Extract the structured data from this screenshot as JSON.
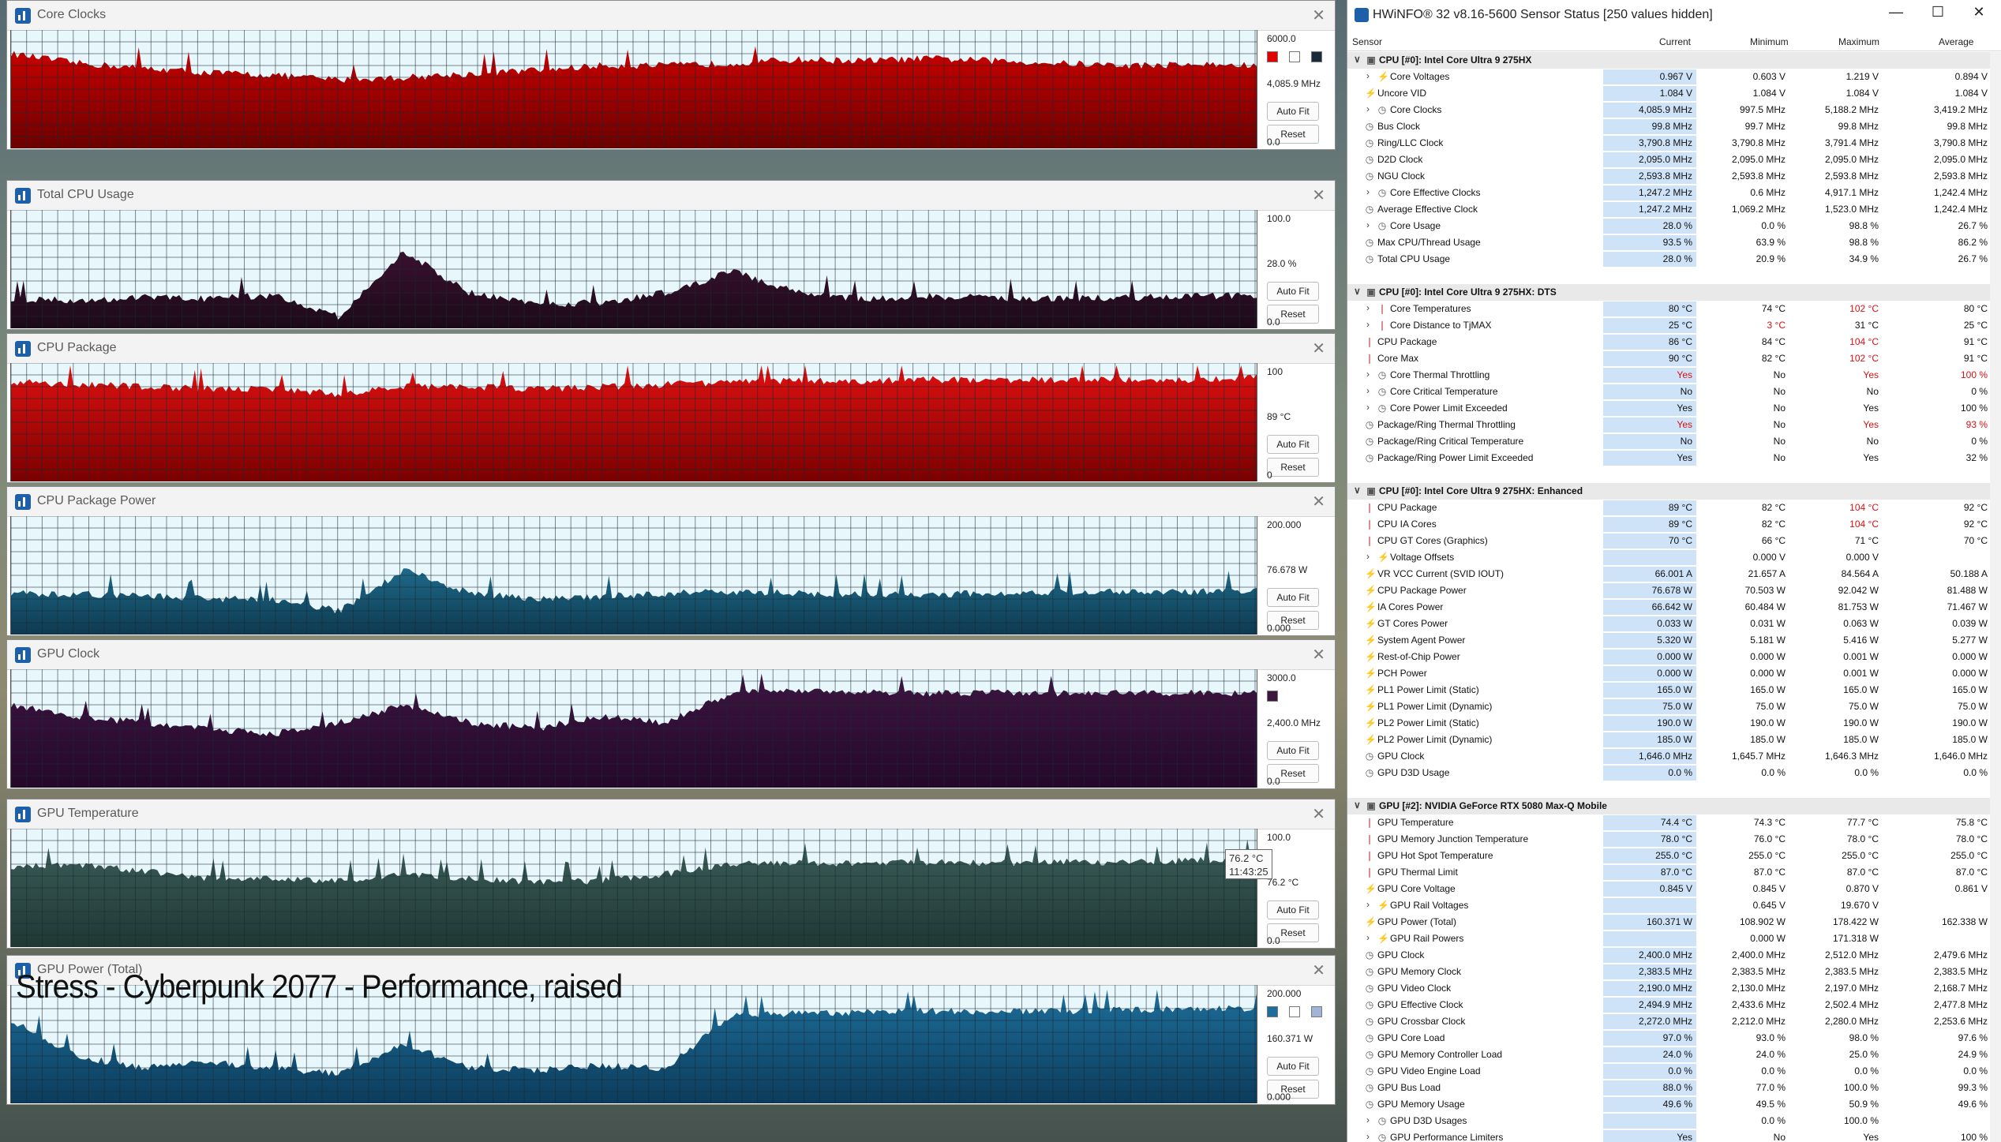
{
  "graphs": [
    {
      "title": "Core Clocks",
      "max": "6000.0",
      "current": "4,085.9 MHz",
      "min": "0.0",
      "autofit": "Auto Fit",
      "reset": "Reset",
      "colors": {
        "fill_top": "#cc0000",
        "fill_bottom": "#6b0000",
        "background": "#e8f7fc"
      },
      "swatches": [
        "#e00000",
        "#ffffff",
        "#1a2b3c"
      ],
      "series_profile": [
        0.8,
        0.72,
        0.68,
        0.64,
        0.62,
        0.58,
        0.6,
        0.63,
        0.66,
        0.7,
        0.7,
        0.72,
        0.75,
        0.74,
        0.76,
        0.74,
        0.72,
        0.7,
        0.71,
        0.7
      ]
    },
    {
      "title": "Total CPU Usage",
      "max": "100.0",
      "current": "28.0 %",
      "min": "0.0",
      "autofit": "Auto Fit",
      "reset": "Reset",
      "colors": {
        "fill_top": "#3a1030",
        "fill_bottom": "#1c0a18",
        "background": "#e8f7fc"
      },
      "swatches": [],
      "series_profile": [
        0.25,
        0.24,
        0.26,
        0.25,
        0.28,
        0.1,
        0.65,
        0.3,
        0.2,
        0.22,
        0.3,
        0.48,
        0.3,
        0.25,
        0.27,
        0.26,
        0.25,
        0.26,
        0.27,
        0.28
      ]
    },
    {
      "title": "CPU Package",
      "max": "100",
      "current": "89 °C",
      "min": "0",
      "autofit": "Auto Fit",
      "reset": "Reset",
      "colors": {
        "fill_top": "#e01010",
        "fill_bottom": "#7a0000",
        "background": "#e8f7fc"
      },
      "swatches": [],
      "series_profile": [
        0.84,
        0.82,
        0.8,
        0.78,
        0.78,
        0.74,
        0.8,
        0.8,
        0.78,
        0.8,
        0.82,
        0.84,
        0.85,
        0.85,
        0.86,
        0.86,
        0.86,
        0.86,
        0.86,
        0.88
      ]
    },
    {
      "title": "CPU Package Power",
      "max": "200.000",
      "current": "76.678 W",
      "min": "0.000",
      "autofit": "Auto Fit",
      "reset": "Reset",
      "colors": {
        "fill_top": "#1e6a8a",
        "fill_bottom": "#0e3a50",
        "background": "#e8f7fc"
      },
      "swatches": [],
      "series_profile": [
        0.35,
        0.34,
        0.33,
        0.3,
        0.3,
        0.2,
        0.55,
        0.35,
        0.3,
        0.32,
        0.35,
        0.36,
        0.35,
        0.34,
        0.34,
        0.35,
        0.36,
        0.36,
        0.36,
        0.38
      ]
    },
    {
      "title": "GPU Clock",
      "max": "3000.0",
      "current": "2,400.0 MHz",
      "min": "0.0",
      "autofit": "Auto Fit",
      "reset": "Reset",
      "colors": {
        "fill_top": "#3d1540",
        "fill_bottom": "#24082a",
        "background": "#e8f7fc"
      },
      "swatches": [
        "#3d1540"
      ],
      "series_profile": [
        0.7,
        0.6,
        0.55,
        0.5,
        0.45,
        0.55,
        0.7,
        0.55,
        0.5,
        0.6,
        0.55,
        0.8,
        0.81,
        0.81,
        0.8,
        0.8,
        0.8,
        0.8,
        0.8,
        0.8
      ]
    },
    {
      "title": "GPU Temperature",
      "max": "100.0",
      "current": "76.2 °C",
      "min": "0.0",
      "autofit": "Auto Fit",
      "reset": "Reset",
      "colors": {
        "fill_top": "#3c5e5a",
        "fill_bottom": "#1f3834",
        "background": "#e8f7fc"
      },
      "swatches": [],
      "series_profile": [
        0.68,
        0.7,
        0.64,
        0.58,
        0.58,
        0.56,
        0.62,
        0.58,
        0.55,
        0.56,
        0.62,
        0.7,
        0.71,
        0.71,
        0.72,
        0.71,
        0.72,
        0.72,
        0.73,
        0.74
      ]
    },
    {
      "title": "GPU Power (Total)",
      "max": "200.000",
      "current": "160.371 W",
      "min": "0.000",
      "autofit": "Auto Fit",
      "reset": "Reset",
      "colors": {
        "fill_top": "#1d6e9a",
        "fill_bottom": "#0c3c5c",
        "background": "#e8f7fc"
      },
      "swatches": [
        "#1d6e9a",
        "#ffffff",
        "#9fb4d6"
      ],
      "series_profile": [
        0.7,
        0.4,
        0.3,
        0.35,
        0.3,
        0.25,
        0.5,
        0.3,
        0.28,
        0.32,
        0.3,
        0.75,
        0.76,
        0.77,
        0.78,
        0.78,
        0.78,
        0.79,
        0.8,
        0.8
      ]
    }
  ],
  "tooltip": {
    "value": "76.2 °C",
    "time": "11:43:25"
  },
  "caption": "Stress - Cyberpunk 2077 - Performance, raised",
  "hwinfo": {
    "title": "HWiNFO® 32 v8.16-5600 Sensor Status [250 values hidden]",
    "window_controls": {
      "minimize": "—",
      "maximize": "☐",
      "close": "✕"
    },
    "columns": {
      "sensor": "Sensor",
      "current": "Current",
      "minimum": "Minimum",
      "maximum": "Maximum",
      "average": "Average"
    },
    "rows": [
      {
        "t": "group",
        "label": "CPU [#0]: Intel Core Ultra 9 275HX"
      },
      {
        "label": "Core Voltages",
        "icon": "volt",
        "expand": true,
        "cur": "0.967 V",
        "min": "0.603 V",
        "max": "1.219 V",
        "avg": "0.894 V"
      },
      {
        "label": "Uncore VID",
        "icon": "volt",
        "cur": "1.084 V",
        "min": "1.084 V",
        "max": "1.084 V",
        "avg": "1.084 V"
      },
      {
        "label": "Core Clocks",
        "icon": "clock",
        "expand": true,
        "cur": "4,085.9 MHz",
        "min": "997.5 MHz",
        "max": "5,188.2 MHz",
        "avg": "3,419.2 MHz"
      },
      {
        "label": "Bus Clock",
        "icon": "clock",
        "cur": "99.8 MHz",
        "min": "99.7 MHz",
        "max": "99.8 MHz",
        "avg": "99.8 MHz"
      },
      {
        "label": "Ring/LLC Clock",
        "icon": "clock",
        "cur": "3,790.8 MHz",
        "min": "3,790.8 MHz",
        "max": "3,791.4 MHz",
        "avg": "3,790.8 MHz"
      },
      {
        "label": "D2D Clock",
        "icon": "clock",
        "cur": "2,095.0 MHz",
        "min": "2,095.0 MHz",
        "max": "2,095.0 MHz",
        "avg": "2,095.0 MHz"
      },
      {
        "label": "NGU Clock",
        "icon": "clock",
        "cur": "2,593.8 MHz",
        "min": "2,593.8 MHz",
        "max": "2,593.8 MHz",
        "avg": "2,593.8 MHz"
      },
      {
        "label": "Core Effective Clocks",
        "icon": "clock",
        "expand": true,
        "cur": "1,247.2 MHz",
        "min": "0.6 MHz",
        "max": "4,917.1 MHz",
        "avg": "1,242.4 MHz"
      },
      {
        "label": "Average Effective Clock",
        "icon": "clock",
        "cur": "1,247.2 MHz",
        "min": "1,069.2 MHz",
        "max": "1,523.0 MHz",
        "avg": "1,242.4 MHz"
      },
      {
        "label": "Core Usage",
        "icon": "clock",
        "expand": true,
        "cur": "28.0 %",
        "min": "0.0 %",
        "max": "98.8 %",
        "avg": "26.7 %"
      },
      {
        "label": "Max CPU/Thread Usage",
        "icon": "clock",
        "cur": "93.5 %",
        "min": "63.9 %",
        "max": "98.8 %",
        "avg": "86.2 %"
      },
      {
        "label": "Total CPU Usage",
        "icon": "clock",
        "cur": "28.0 %",
        "min": "20.9 %",
        "max": "34.9 %",
        "avg": "26.7 %"
      },
      {
        "t": "blank"
      },
      {
        "t": "group",
        "label": "CPU [#0]: Intel Core Ultra 9 275HX: DTS"
      },
      {
        "label": "Core Temperatures",
        "icon": "temp",
        "expand": true,
        "cur": "80 °C",
        "min": "74 °C",
        "max": "102 °C",
        "avg": "80 °C",
        "maxRed": true
      },
      {
        "label": "Core Distance to TjMAX",
        "icon": "temp",
        "expand": true,
        "cur": "25 °C",
        "min": "3 °C",
        "max": "31 °C",
        "avg": "25 °C",
        "minRed": true
      },
      {
        "label": "CPU Package",
        "icon": "temp",
        "cur": "86 °C",
        "min": "84 °C",
        "max": "104 °C",
        "avg": "91 °C",
        "maxRed": true
      },
      {
        "label": "Core Max",
        "icon": "temp",
        "cur": "90 °C",
        "min": "82 °C",
        "max": "102 °C",
        "avg": "91 °C",
        "maxRed": true
      },
      {
        "label": "Core Thermal Throttling",
        "icon": "clock",
        "expand": true,
        "cur": "Yes",
        "min": "No",
        "max": "Yes",
        "avg": "100 %",
        "curRed": true,
        "maxRed": true,
        "avgRed": true
      },
      {
        "label": "Core Critical Temperature",
        "icon": "clock",
        "expand": true,
        "cur": "No",
        "min": "No",
        "max": "No",
        "avg": "0 %"
      },
      {
        "label": "Core Power Limit Exceeded",
        "icon": "clock",
        "expand": true,
        "cur": "Yes",
        "min": "No",
        "max": "Yes",
        "avg": "100 %"
      },
      {
        "label": "Package/Ring Thermal Throttling",
        "icon": "clock",
        "cur": "Yes",
        "min": "No",
        "max": "Yes",
        "avg": "93 %",
        "curRed": true,
        "maxRed": true,
        "avgRed": true
      },
      {
        "label": "Package/Ring Critical Temperature",
        "icon": "clock",
        "cur": "No",
        "min": "No",
        "max": "No",
        "avg": "0 %"
      },
      {
        "label": "Package/Ring Power Limit Exceeded",
        "icon": "clock",
        "cur": "Yes",
        "min": "No",
        "max": "Yes",
        "avg": "32 %"
      },
      {
        "t": "blank"
      },
      {
        "t": "group",
        "label": "CPU [#0]: Intel Core Ultra 9 275HX: Enhanced"
      },
      {
        "label": "CPU Package",
        "icon": "temp",
        "cur": "89 °C",
        "min": "82 °C",
        "max": "104 °C",
        "avg": "92 °C",
        "maxRed": true
      },
      {
        "label": "CPU IA Cores",
        "icon": "temp",
        "cur": "89 °C",
        "min": "82 °C",
        "max": "104 °C",
        "avg": "92 °C",
        "maxRed": true
      },
      {
        "label": "CPU GT Cores (Graphics)",
        "icon": "temp",
        "cur": "70 °C",
        "min": "66 °C",
        "max": "71 °C",
        "avg": "70 °C"
      },
      {
        "label": "Voltage Offsets",
        "icon": "volt",
        "expand": true,
        "cur": "",
        "min": "0.000 V",
        "max": "0.000 V",
        "avg": ""
      },
      {
        "label": "VR VCC Current (SVID IOUT)",
        "icon": "volt",
        "cur": "66.001 A",
        "min": "21.657 A",
        "max": "84.564 A",
        "avg": "50.188 A"
      },
      {
        "label": "CPU Package Power",
        "icon": "volt",
        "cur": "76.678 W",
        "min": "70.503 W",
        "max": "92.042 W",
        "avg": "81.488 W"
      },
      {
        "label": "IA Cores Power",
        "icon": "volt",
        "cur": "66.642 W",
        "min": "60.484 W",
        "max": "81.753 W",
        "avg": "71.467 W"
      },
      {
        "label": "GT Cores Power",
        "icon": "volt",
        "cur": "0.033 W",
        "min": "0.031 W",
        "max": "0.063 W",
        "avg": "0.039 W"
      },
      {
        "label": "System Agent Power",
        "icon": "volt",
        "cur": "5.320 W",
        "min": "5.181 W",
        "max": "5.416 W",
        "avg": "5.277 W"
      },
      {
        "label": "Rest-of-Chip Power",
        "icon": "volt",
        "cur": "0.000 W",
        "min": "0.000 W",
        "max": "0.001 W",
        "avg": "0.000 W"
      },
      {
        "label": "PCH Power",
        "icon": "volt",
        "cur": "0.000 W",
        "min": "0.000 W",
        "max": "0.001 W",
        "avg": "0.000 W"
      },
      {
        "label": "PL1 Power Limit (Static)",
        "icon": "volt",
        "cur": "165.0 W",
        "min": "165.0 W",
        "max": "165.0 W",
        "avg": "165.0 W"
      },
      {
        "label": "PL1 Power Limit (Dynamic)",
        "icon": "volt",
        "cur": "75.0 W",
        "min": "75.0 W",
        "max": "75.0 W",
        "avg": "75.0 W"
      },
      {
        "label": "PL2 Power Limit (Static)",
        "icon": "volt",
        "cur": "190.0 W",
        "min": "190.0 W",
        "max": "190.0 W",
        "avg": "190.0 W"
      },
      {
        "label": "PL2 Power Limit (Dynamic)",
        "icon": "volt",
        "cur": "185.0 W",
        "min": "185.0 W",
        "max": "185.0 W",
        "avg": "185.0 W"
      },
      {
        "label": "GPU Clock",
        "icon": "clock",
        "cur": "1,646.0 MHz",
        "min": "1,645.7 MHz",
        "max": "1,646.3 MHz",
        "avg": "1,646.0 MHz"
      },
      {
        "label": "GPU D3D Usage",
        "icon": "clock",
        "cur": "0.0 %",
        "min": "0.0 %",
        "max": "0.0 %",
        "avg": "0.0 %"
      },
      {
        "t": "blank"
      },
      {
        "t": "group",
        "label": "GPU [#2]: NVIDIA  GeForce RTX 5080 Max-Q Mobile"
      },
      {
        "label": "GPU Temperature",
        "icon": "temp",
        "cur": "74.4 °C",
        "min": "74.3 °C",
        "max": "77.7 °C",
        "avg": "75.8 °C"
      },
      {
        "label": "GPU Memory Junction Temperature",
        "icon": "temp",
        "cur": "78.0 °C",
        "min": "76.0 °C",
        "max": "78.0 °C",
        "avg": "78.0 °C"
      },
      {
        "label": "GPU Hot Spot Temperature",
        "icon": "temp",
        "cur": "255.0 °C",
        "min": "255.0 °C",
        "max": "255.0 °C",
        "avg": "255.0 °C"
      },
      {
        "label": "GPU Thermal Limit",
        "icon": "temp",
        "cur": "87.0 °C",
        "min": "87.0 °C",
        "max": "87.0 °C",
        "avg": "87.0 °C"
      },
      {
        "label": "GPU Core Voltage",
        "icon": "volt",
        "cur": "0.845 V",
        "min": "0.845 V",
        "max": "0.870 V",
        "avg": "0.861 V"
      },
      {
        "label": "GPU Rail Voltages",
        "icon": "volt",
        "expand": true,
        "cur": "",
        "min": "0.645 V",
        "max": "19.670 V",
        "avg": ""
      },
      {
        "label": "GPU Power (Total)",
        "icon": "volt",
        "cur": "160.371 W",
        "min": "108.902 W",
        "max": "178.422 W",
        "avg": "162.338 W"
      },
      {
        "label": "GPU Rail Powers",
        "icon": "volt",
        "expand": true,
        "cur": "",
        "min": "0.000 W",
        "max": "171.318 W",
        "avg": ""
      },
      {
        "label": "GPU Clock",
        "icon": "clock",
        "cur": "2,400.0 MHz",
        "min": "2,400.0 MHz",
        "max": "2,512.0 MHz",
        "avg": "2,479.6 MHz"
      },
      {
        "label": "GPU Memory Clock",
        "icon": "clock",
        "cur": "2,383.5 MHz",
        "min": "2,383.5 MHz",
        "max": "2,383.5 MHz",
        "avg": "2,383.5 MHz"
      },
      {
        "label": "GPU Video Clock",
        "icon": "clock",
        "cur": "2,190.0 MHz",
        "min": "2,130.0 MHz",
        "max": "2,197.0 MHz",
        "avg": "2,168.7 MHz"
      },
      {
        "label": "GPU Effective Clock",
        "icon": "clock",
        "cur": "2,494.9 MHz",
        "min": "2,433.6 MHz",
        "max": "2,502.4 MHz",
        "avg": "2,477.8 MHz"
      },
      {
        "label": "GPU Crossbar Clock",
        "icon": "clock",
        "cur": "2,272.0 MHz",
        "min": "2,212.0 MHz",
        "max": "2,280.0 MHz",
        "avg": "2,253.6 MHz"
      },
      {
        "label": "GPU Core Load",
        "icon": "clock",
        "cur": "97.0 %",
        "min": "93.0 %",
        "max": "98.0 %",
        "avg": "97.6 %"
      },
      {
        "label": "GPU Memory Controller Load",
        "icon": "clock",
        "cur": "24.0 %",
        "min": "24.0 %",
        "max": "25.0 %",
        "avg": "24.9 %"
      },
      {
        "label": "GPU Video Engine Load",
        "icon": "clock",
        "cur": "0.0 %",
        "min": "0.0 %",
        "max": "0.0 %",
        "avg": "0.0 %"
      },
      {
        "label": "GPU Bus Load",
        "icon": "clock",
        "cur": "88.0 %",
        "min": "77.0 %",
        "max": "100.0 %",
        "avg": "99.3 %"
      },
      {
        "label": "GPU Memory Usage",
        "icon": "clock",
        "cur": "49.6 %",
        "min": "49.5 %",
        "max": "50.9 %",
        "avg": "49.6 %"
      },
      {
        "label": "GPU D3D Usages",
        "icon": "clock",
        "expand": true,
        "cur": "",
        "min": "0.0 %",
        "max": "100.0 %",
        "avg": ""
      },
      {
        "label": "GPU Performance Limiters",
        "icon": "clock",
        "expand": true,
        "cur": "Yes",
        "min": "No",
        "max": "Yes",
        "avg": "100 %"
      }
    ]
  }
}
